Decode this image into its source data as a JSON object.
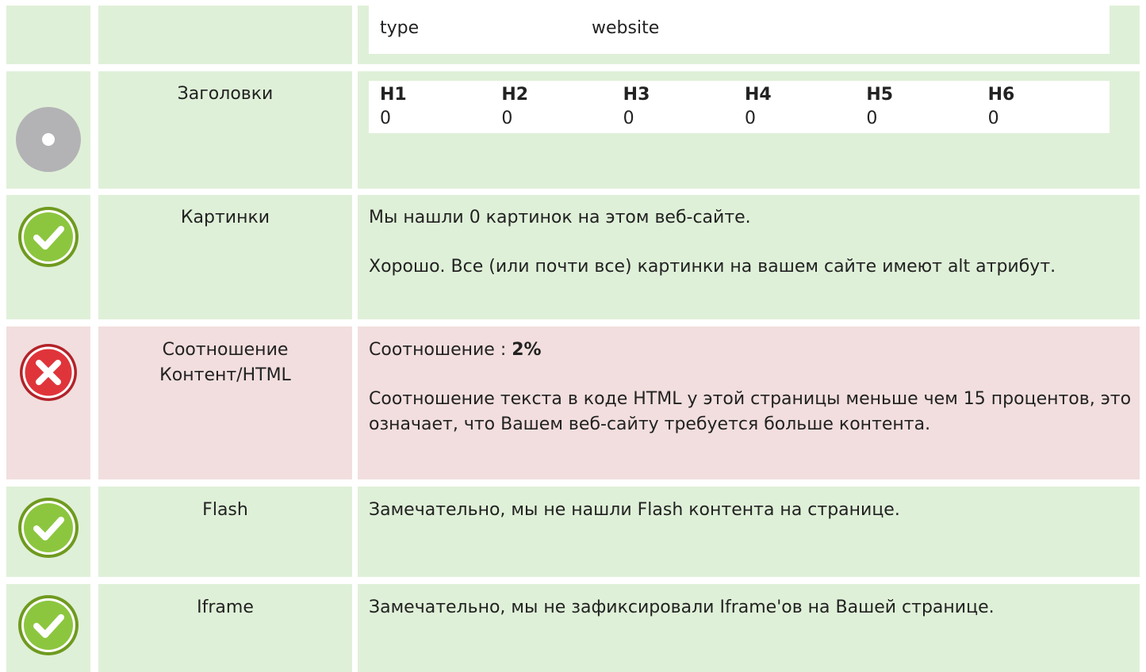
{
  "og_row": {
    "key": "type",
    "value": "website"
  },
  "headings": {
    "label": "Заголовки",
    "status": "neutral",
    "columns": [
      {
        "name": "H1",
        "count": "0"
      },
      {
        "name": "H2",
        "count": "0"
      },
      {
        "name": "H3",
        "count": "0"
      },
      {
        "name": "H4",
        "count": "0"
      },
      {
        "name": "H5",
        "count": "0"
      },
      {
        "name": "H6",
        "count": "0"
      }
    ]
  },
  "images": {
    "label": "Картинки",
    "status": "ok",
    "line1": "Мы нашли 0 картинок на этом веб-сайте.",
    "line2": "Хорошо. Все (или почти все) картинки на вашем сайте имеют alt атрибут."
  },
  "ratio": {
    "label": "Соотношение Контент/HTML",
    "status": "error",
    "ratio_prefix": "Соотношение : ",
    "ratio_value": "2%",
    "description": "Соотношение текста в коде HTML у этой страницы меньше чем 15 процентов, это означает, что Вашем веб-сайту требуется больше контента."
  },
  "flash": {
    "label": "Flash",
    "status": "ok",
    "text": "Замечательно, мы не нашли Flash контента на странице."
  },
  "iframe": {
    "label": "Iframe",
    "status": "ok",
    "text": "Замечательно, мы не зафиксировали Iframe'ов на Вашей странице."
  },
  "colors": {
    "ok_bg": "#dff0d8",
    "error_bg": "#f2dede",
    "ok_icon": "#8cc63f",
    "error_icon": "#e0343b",
    "neutral_icon": "#b3b3b5"
  }
}
